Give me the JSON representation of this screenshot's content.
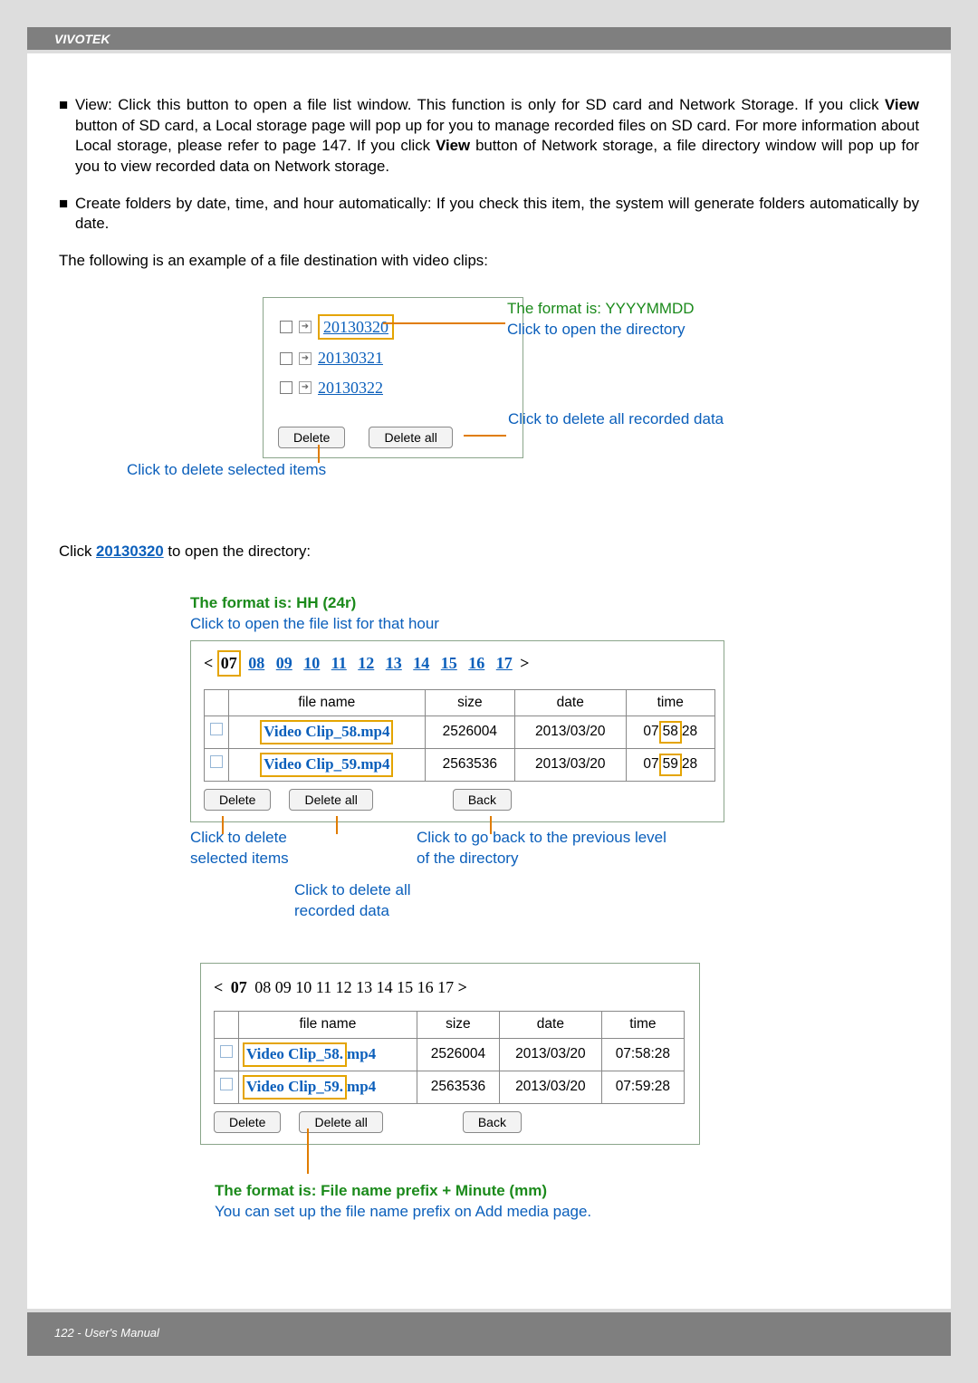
{
  "brand": "VIVOTEK",
  "bullets": {
    "view": {
      "pre": "View: Click this button to open a file list window. This function is only for SD card and Network Storage. If you click ",
      "b1": "View",
      "mid1": " button of SD card, a Local storage page will pop up for you to manage recorded files on SD card. For more information about Local storage, please refer to page 147.  If you click ",
      "b2": "View",
      "mid2": " button of Network storage, a file directory window will pop up for you to view recorded data on Network storage."
    },
    "create": "Create folders by date, time, and hour automatically: If you check this item, the system will generate folders automatically by date."
  },
  "lead": "The following is an example of a file destination with video clips:",
  "folders": {
    "items": [
      "20130320",
      "20130321",
      "20130322"
    ],
    "delete": "Delete",
    "delete_all": "Delete all"
  },
  "anno": {
    "fmt_date": "The format is: YYYYMMDD",
    "open_dir": "Click to open the directory",
    "delete_all_data": "Click to delete all recorded data",
    "delete_selected": "Click to delete selected items"
  },
  "click_open": {
    "pre": "Click ",
    "link": "20130320",
    "post": " to open the directory:"
  },
  "hour_anno": {
    "fmt": "The format is: HH (24r)",
    "sub": "Click to open the file list for that hour"
  },
  "hours": [
    "07",
    "08",
    "09",
    "10",
    "11",
    "12",
    "13",
    "14",
    "15",
    "16",
    "17"
  ],
  "table": {
    "headers": [
      "file name",
      "size",
      "date",
      "time"
    ],
    "rows": [
      {
        "chk": true,
        "name": "Video Clip_58.mp4",
        "size": "2526004",
        "date": "2013/03/20",
        "time": "07:58:28",
        "min": "58"
      },
      {
        "chk": true,
        "name": "Video Clip_59.mp4",
        "size": "2563536",
        "date": "2013/03/20",
        "time": "07:59:28",
        "min": "59"
      }
    ]
  },
  "btns": {
    "delete": "Delete",
    "delete_all": "Delete all",
    "back": "Back"
  },
  "anno2": {
    "del_sel": "Click to delete selected items",
    "back": "Click to go back to the previous level of the directory",
    "del_all": "Click to delete all recorded data"
  },
  "table3": {
    "rows": [
      {
        "name": "Video Clip_58.",
        "ext": "mp4",
        "size": "2526004",
        "date": "2013/03/20",
        "time": "07:58:28"
      },
      {
        "name": "Video Clip_59.",
        "ext": "mp4",
        "size": "2563536",
        "date": "2013/03/20",
        "time": "07:59:28"
      }
    ]
  },
  "anno3": {
    "fmt": "The format is: File name prefix + Minute (mm)",
    "sub": "You can set up the file name prefix on Add media page."
  },
  "footer": "122 - User's Manual"
}
